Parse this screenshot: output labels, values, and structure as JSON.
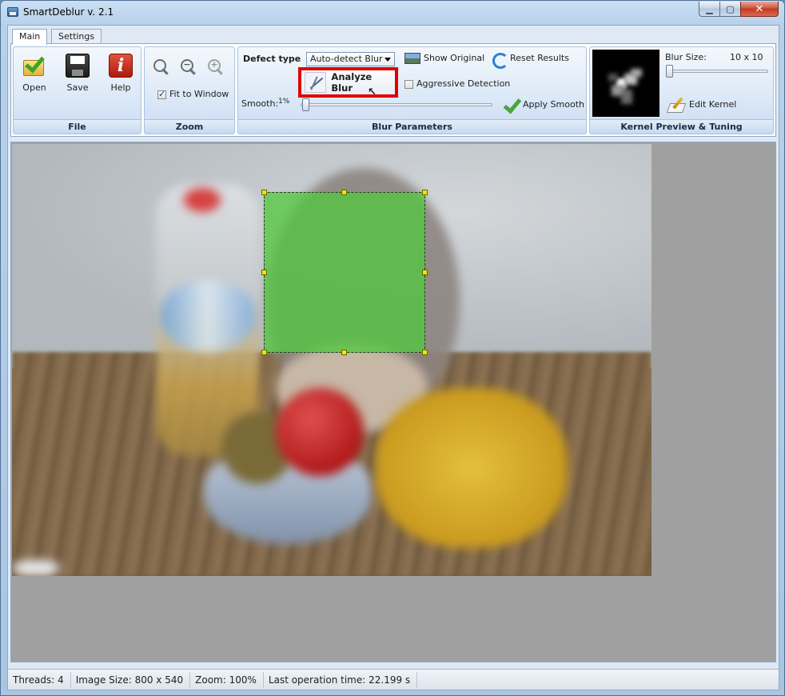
{
  "window": {
    "title": "SmartDeblur v. 2.1"
  },
  "tabs": [
    {
      "label": "Main"
    },
    {
      "label": "Settings"
    }
  ],
  "file_group": {
    "label": "File",
    "open_label": "Open",
    "save_label": "Save",
    "help_label": "Help"
  },
  "zoom_group": {
    "label": "Zoom",
    "fit_to_window_label": "Fit to Window",
    "fit_to_window_checked": true,
    "zoom_in_glyph": "+",
    "zoom_out_glyph": "−"
  },
  "blur_params": {
    "label": "Blur Parameters",
    "defect_type_label": "Defect type",
    "defect_type_value": "Auto-detect Blur",
    "show_original_label": "Show Original",
    "reset_results_label": "Reset Results",
    "analyze_blur_label": "Analyze Blur",
    "aggressive_detection_label": "Aggressive Detection",
    "aggressive_detection_checked": false,
    "smooth_label": "Smooth:",
    "smooth_value": "1%",
    "smooth_percent": 1,
    "apply_smooth_label": "Apply Smooth"
  },
  "kernel": {
    "label": "Kernel Preview & Tuning",
    "blur_size_label": "Blur Size:",
    "blur_size_value": "10 x 10",
    "edit_kernel_label": "Edit Kernel"
  },
  "status": {
    "threads": "Threads: 4",
    "image_size": "Image Size: 800 x 540",
    "zoom": "Zoom: 100%",
    "last_op": "Last operation time: 22.199 s"
  },
  "colors": {
    "selection_fill": "#4fc43c",
    "highlight_red": "#e00000",
    "handle_yellow": "#e5e517"
  }
}
